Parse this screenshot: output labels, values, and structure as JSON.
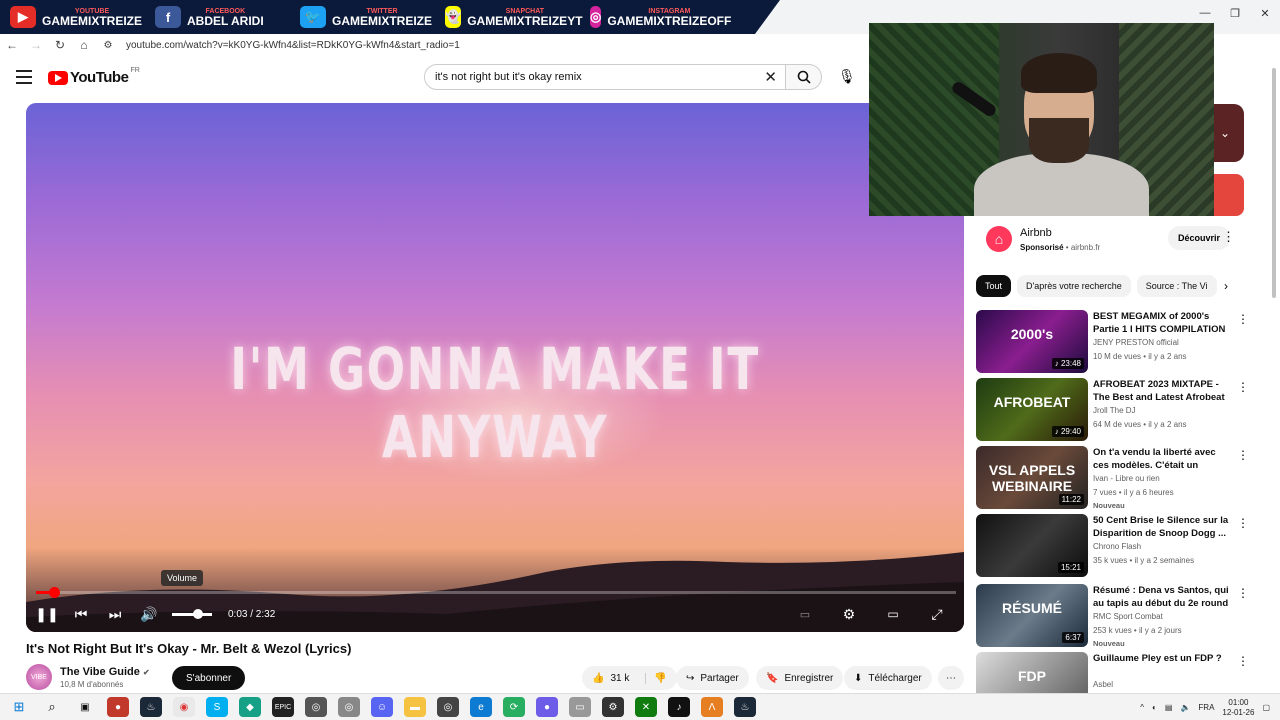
{
  "social": [
    {
      "network": "YOUTUBE",
      "name": "GAMEMIXTREIZE",
      "logo": "▶",
      "color": "#e52d27",
      "icon": "youtube-icon"
    },
    {
      "network": "FACEBOOK",
      "name": "ABDEL ARIDI",
      "logo": "f",
      "color": "#3b5998",
      "icon": "facebook-icon"
    },
    {
      "network": "TWITTER",
      "name": "GAMEMIXTREIZE",
      "logo": "🐦",
      "color": "#1da1f2",
      "icon": "twitter-icon"
    },
    {
      "network": "SNAPCHAT",
      "name": "GAMEMIXTREIZEYT",
      "logo": "👻",
      "color": "#fffc00",
      "icon": "snapchat-icon"
    },
    {
      "network": "INSTAGRAM",
      "name": "GAMEMIXTREIZEOFF",
      "logo": "◎",
      "color": "#d6249f",
      "icon": "instagram-icon"
    }
  ],
  "browser": {
    "url": "youtube.com/watch?v=kK0YG-kWfn4&list=RDkK0YG-kWfn4&start_radio=1"
  },
  "header": {
    "logo_text": "YouTube",
    "country_code": "FR",
    "search_value": "it's not right but it's okay remix"
  },
  "player": {
    "lyric": "I'M GONNA MAKE IT ANYWAY",
    "time": "0:03 / 2:32",
    "progress": 0.02,
    "volume": 0.65,
    "tooltip": "Volume"
  },
  "video": {
    "title": "It's Not Right But It's Okay - Mr. Belt & Wezol (Lyrics)",
    "channel": "The Vibe Guide",
    "avatar_text": "VIBE",
    "subscribers": "10,8 M d'abonnés",
    "subscribe_label": "S'abonner",
    "likes": "31 k",
    "share_label": "Partager",
    "save_label": "Enregistrer",
    "download_label": "Télécharger"
  },
  "ad": {
    "name": "Airbnb",
    "sponsored": "Sponsorisé",
    "domain": "airbnb.fr",
    "button": "Découvrir"
  },
  "chips": [
    "Tout",
    "D'après votre recherche",
    "Source : The Vi"
  ],
  "recommendations": [
    {
      "title": "BEST MEGAMIX of 2000's Partie 1 I HITS COMPILATION ...",
      "channel": "JENY PRESTON official",
      "meta": "10 M de vues • il y a 2 ans",
      "duration": "♪ 23:48",
      "thumb_text": "2000's",
      "thumb_bg": "linear-gradient(135deg,#2b0a4a,#8a1e8f,#1b0b3b)",
      "new": ""
    },
    {
      "title": "AFROBEAT 2023 MIXTAPE - The Best and Latest Afrobeat Jam...",
      "channel": "Jroll The DJ",
      "meta": "64 M de vues • il y a 2 ans",
      "duration": "♪ 29:40",
      "thumb_text": "AFROBEAT",
      "thumb_bg": "linear-gradient(135deg,#1e3b12,#4f6b1a,#2a1a08)",
      "new": ""
    },
    {
      "title": "On t'a vendu la liberté avec ces modèles. C'était un mensonge.",
      "channel": "Ivan - Libre ou rien",
      "meta": "7 vues • il y a 6 heures",
      "duration": "11:22",
      "thumb_text": "VSL APPELS WEBINAIRE",
      "thumb_bg": "linear-gradient(135deg,#3b2a2a,#6a4a3a,#222)",
      "new": "Nouveau"
    },
    {
      "title": "50 Cent Brise le Silence sur la Disparition de Snoop Dogg ...",
      "channel": "Chrono Flash",
      "meta": "35 k vues • il y a 2 semaines",
      "duration": "15:21",
      "thumb_text": "",
      "thumb_bg": "linear-gradient(135deg,#111,#3a3a3a,#0c0c0c)",
      "new": ""
    },
    {
      "title": "Résumé : Dena vs Santos, qui au tapis au début du 2e round ...",
      "channel": "RMC Sport Combat",
      "meta": "253 k vues • il y a 2 jours",
      "duration": "6:37",
      "thumb_text": "RÉSUMÉ",
      "thumb_bg": "linear-gradient(135deg,#2a3a4a,#6b7b8a,#1a2a3a)",
      "new": "Nouveau"
    },
    {
      "title": "Guillaume Pley est un FDP ?",
      "channel": "Asbel",
      "meta": "",
      "duration": "",
      "thumb_text": "FDP",
      "thumb_bg": "linear-gradient(135deg,#ddd,#999,#555)",
      "new": ""
    }
  ],
  "taskbar": {
    "language": "FRA",
    "time": "01:00",
    "date": "12-01-26"
  }
}
